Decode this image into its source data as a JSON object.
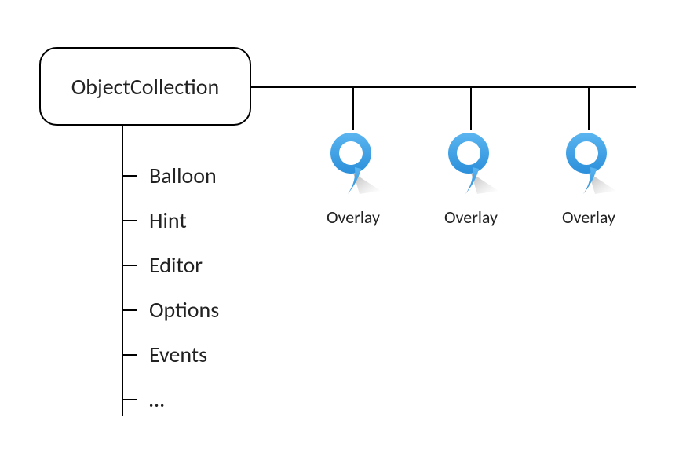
{
  "root": {
    "label": "ObjectCollection"
  },
  "children": [
    {
      "label": "Balloon"
    },
    {
      "label": "Hint"
    },
    {
      "label": "Editor"
    },
    {
      "label": "Options"
    },
    {
      "label": "Events"
    },
    {
      "label": "…"
    }
  ],
  "overlays": [
    {
      "label": "Overlay"
    },
    {
      "label": "Overlay"
    },
    {
      "label": "Overlay"
    }
  ],
  "colors": {
    "icon_fill": "#3399e6",
    "icon_stroke": "#2b8fda",
    "shadow": "#888"
  }
}
